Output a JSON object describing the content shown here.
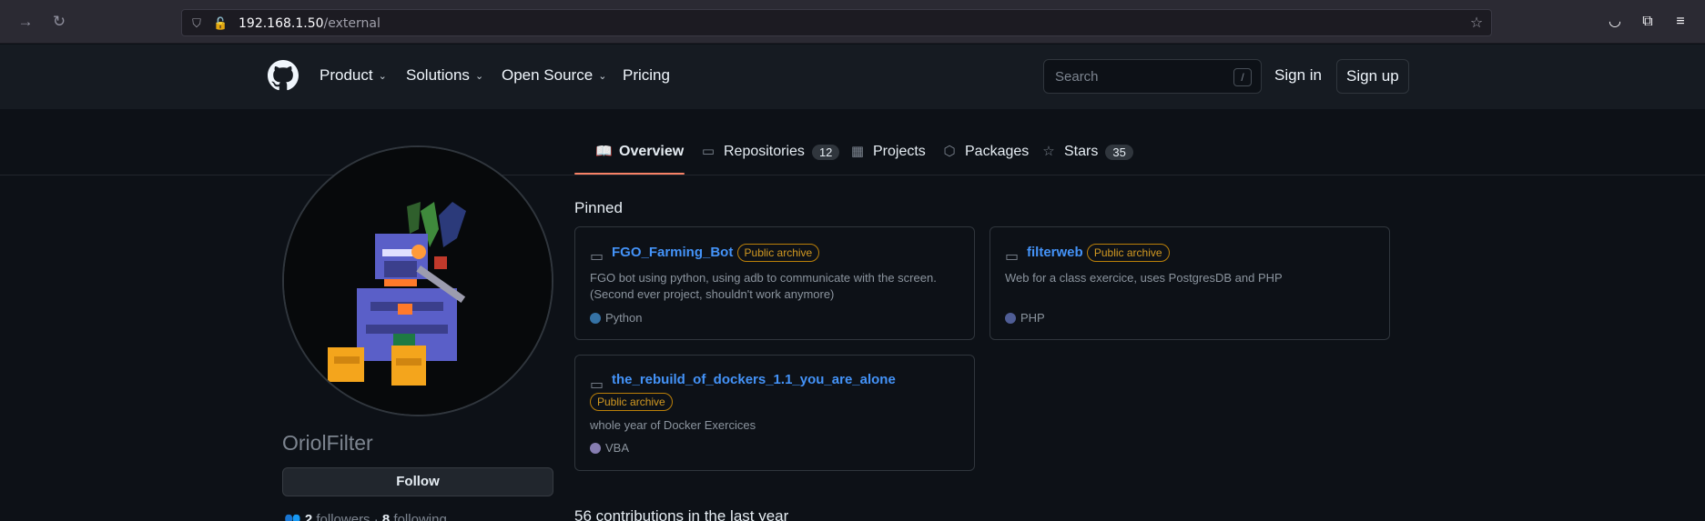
{
  "browser": {
    "url_host": "192.168.1.50",
    "url_path": "/external"
  },
  "header": {
    "nav": [
      {
        "label": "Product"
      },
      {
        "label": "Solutions"
      },
      {
        "label": "Open Source"
      },
      {
        "label": "Pricing"
      }
    ],
    "search_placeholder": "Search",
    "search_shortcut": "/",
    "sign_in": "Sign in",
    "sign_up": "Sign up"
  },
  "tabs": [
    {
      "label": "Overview",
      "icon": "book-icon",
      "active": true
    },
    {
      "label": "Repositories",
      "icon": "repo-icon",
      "count": "12"
    },
    {
      "label": "Projects",
      "icon": "table-icon"
    },
    {
      "label": "Packages",
      "icon": "package-icon"
    },
    {
      "label": "Stars",
      "icon": "star-icon",
      "count": "35"
    }
  ],
  "profile": {
    "username": "OriolFilter",
    "follow_label": "Follow",
    "followers_count": "2",
    "followers_label": "followers",
    "following_count": "8",
    "following_label": "following"
  },
  "pinned": {
    "title": "Pinned",
    "repos": [
      {
        "name": "FGO_Farming_Bot",
        "badge": "Public archive",
        "description": "FGO bot using python, using adb to communicate with the screen.",
        "description2": "(Second ever project, shouldn't work anymore)",
        "language": "Python",
        "lang_color": "#3572A5"
      },
      {
        "name": "filterweb",
        "badge": "Public archive",
        "description": "Web for a class exercice, uses PostgresDB and PHP",
        "language": "PHP",
        "lang_color": "#4F5D95"
      },
      {
        "name": "the_rebuild_of_dockers_1.1_you_are_alone",
        "badge": "Public archive",
        "description": "whole year of Docker Exercices",
        "language": "VBA",
        "lang_color": "#867db1"
      }
    ]
  },
  "contributions_title": "56 contributions in the last year",
  "colors": {
    "accent_link": "#4493f8",
    "archive_badge": "#d29922",
    "active_tab_underline": "#f78166"
  }
}
